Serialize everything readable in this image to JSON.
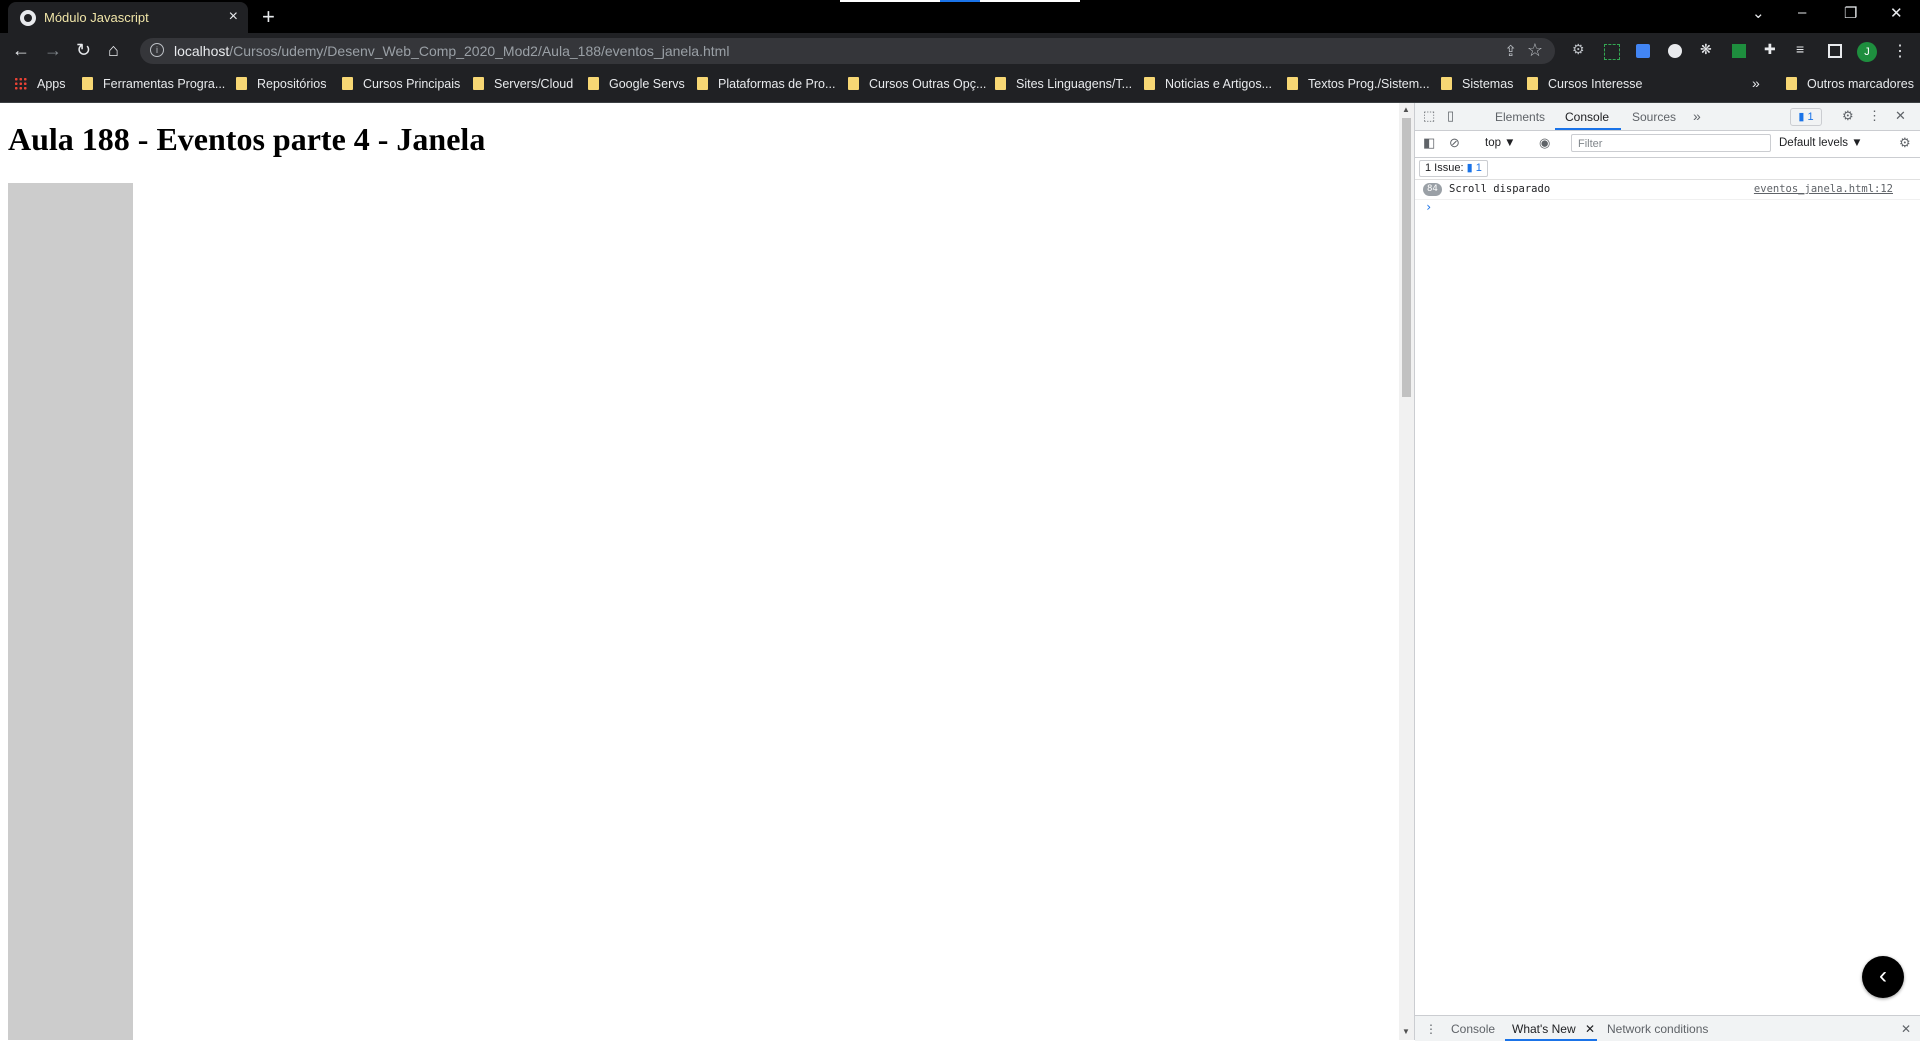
{
  "browser": {
    "tab_title": "Módulo Javascript",
    "tab_close": "×",
    "new_tab": "+",
    "window_controls": [
      "⌄",
      "–",
      "❐",
      "✕"
    ],
    "url_host": "localhost",
    "url_path": "/Cursos/udemy/Desenv_Web_Comp_2020_Mod2/Aula_188/eventos_janela.html",
    "avatar_letter": "J",
    "extension_colors": [
      "#bdc1c6",
      "#34a853",
      "#4285f4",
      "#e8eaed",
      "#e8eaed",
      "#1e8e3e",
      "#e8eaed",
      "#e8eaed",
      "#e8eaed"
    ]
  },
  "bookmarks": {
    "apps": "Apps",
    "items": [
      "Ferramentas Progra...",
      "Repositórios",
      "Cursos Principais",
      "Servers/Cloud",
      "Google Servs",
      "Plataformas de Pro...",
      "Cursos Outras Opç...",
      "Sites Linguagens/T...",
      "Noticias e Artigos...",
      "Textos Prog./Sistem...",
      "Sistemas",
      "Cursos Interesse"
    ],
    "overflow": "»",
    "other": "Outros marcadores"
  },
  "page": {
    "heading": "Aula 188 - Eventos parte 4 - Janela"
  },
  "devtools": {
    "tabs": [
      "Elements",
      "Console",
      "Sources"
    ],
    "active_tab": "Console",
    "more_tabs": "»",
    "issues_badge": "1",
    "context": "top ▼",
    "filter_placeholder": "Filter",
    "levels": "Default levels ▼",
    "issues_label": "1 Issue:",
    "issues_count": "1",
    "console_count": "84",
    "console_message": "Scroll disparado",
    "console_source": "eventos_janela.html:12",
    "prompt": "›",
    "fab_icon": "‹",
    "drawer_tabs": [
      "Console",
      "What's New",
      "Network conditions"
    ],
    "drawer_active": "What's New",
    "drawer_close": "✕",
    "close_icon": "✕"
  },
  "colors": {
    "chrome_dark": "#202124",
    "accent_blue": "#1a73e8",
    "folder_yellow": "#f7d774",
    "box_gray": "#cccccc"
  }
}
